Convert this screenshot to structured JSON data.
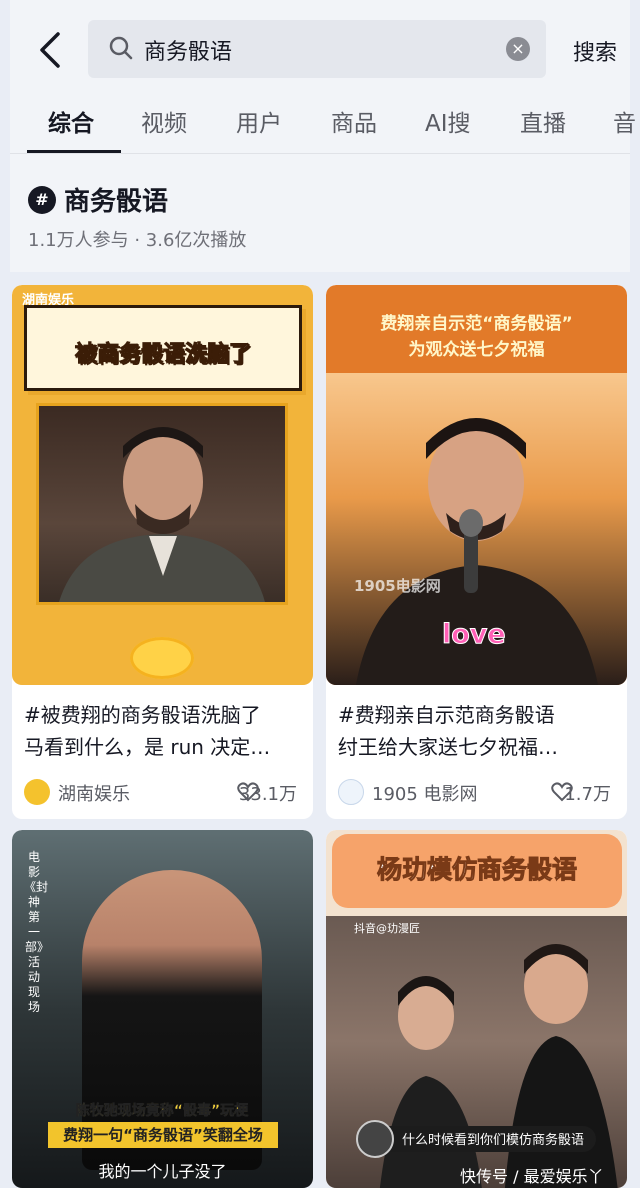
{
  "header": {
    "search_query": "商务骰语",
    "search_button": "搜索",
    "clear_label": "×"
  },
  "tabs": [
    "综合",
    "视频",
    "用户",
    "商品",
    "AI搜",
    "直播",
    "音"
  ],
  "topic": {
    "hash": "#",
    "title": "商务骰语",
    "stats": "1.1万人参与 · 3.6亿次播放"
  },
  "cards": [
    {
      "thumb_brand": "湖南娱乐",
      "thumb_caption": "被商务骰语洗脑了",
      "title_line1": "#被费翔的商务骰语洗脑了",
      "title_line2": "马看到什么，是 run 决定…",
      "author": "湖南娱乐",
      "likes": "33.1万"
    },
    {
      "thumb_caption_line1": "费翔亲自示范“商务骰语”",
      "thumb_caption_line2": "为观众送七夕祝福",
      "thumb_watermark": "1905电影网",
      "thumb_overlay": "love",
      "title_line1": "#费翔亲自示范商务骰语",
      "title_line2": "纣王给大家送七夕祝福…",
      "author": "1905 电影网",
      "likes": "1.7万"
    },
    {
      "thumb_vertical": "电影《封神第一部》活动现场",
      "thumb_sub1": "陈牧驰现场竟称“骰毒”玩梗",
      "thumb_sub2": "费翔一句“商务骰语”笑翻全场",
      "thumb_sub3": "我的一个儿子没了"
    },
    {
      "thumb_title": "杨玏模仿商务骰语",
      "thumb_tag": "抖音@玏漫匠",
      "thumb_sub": "什么时候看到你们模仿商务骰语"
    }
  ],
  "footer": "快传号 / 最爱娱乐丫",
  "colors": {
    "accent": "#161823",
    "background": "#e9edf5"
  },
  "icons": [
    "back-arrow-icon",
    "search-icon",
    "clear-icon",
    "hashtag-icon",
    "heart-icon"
  ]
}
